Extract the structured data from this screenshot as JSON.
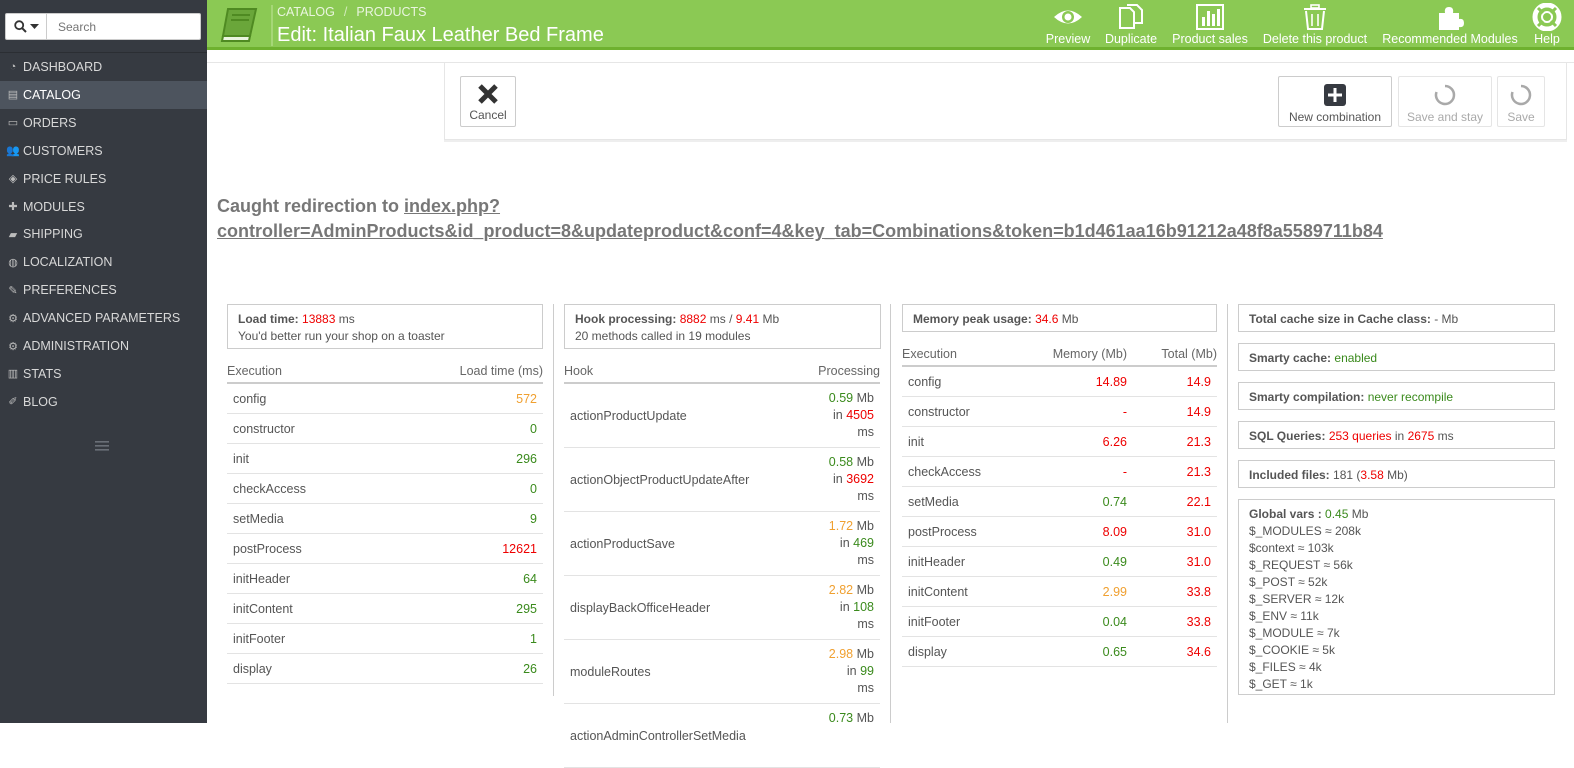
{
  "search": {
    "placeholder": "Search"
  },
  "sidebar": {
    "items": [
      {
        "label": "DASHBOARD",
        "icon": "dashboard-icon"
      },
      {
        "label": "CATALOG",
        "icon": "book-icon"
      },
      {
        "label": "ORDERS",
        "icon": "credit-card-icon"
      },
      {
        "label": "CUSTOMERS",
        "icon": "users-icon"
      },
      {
        "label": "PRICE RULES",
        "icon": "tags-icon"
      },
      {
        "label": "MODULES",
        "icon": "puzzle-icon"
      },
      {
        "label": "SHIPPING",
        "icon": "truck-icon"
      },
      {
        "label": "LOCALIZATION",
        "icon": "globe-icon"
      },
      {
        "label": "PREFERENCES",
        "icon": "wrench-icon"
      },
      {
        "label": "ADVANCED PARAMETERS",
        "icon": "cogs-icon"
      },
      {
        "label": "ADMINISTRATION",
        "icon": "cog-icon"
      },
      {
        "label": "STATS",
        "icon": "bar-chart-icon"
      },
      {
        "label": "BLOG",
        "icon": "edit-icon"
      }
    ],
    "active_index": 1
  },
  "header": {
    "breadcrumb": [
      "CATALOG",
      "PRODUCTS"
    ],
    "breadcrumb_sep": "/",
    "title": "Edit: Italian Faux Leather Bed Frame",
    "toolbar": {
      "preview": "Preview",
      "duplicate": "Duplicate",
      "product_sales": "Product sales",
      "delete": "Delete this product",
      "recommended": "Recommended Modules",
      "help": "Help"
    }
  },
  "actions": {
    "cancel": "Cancel",
    "new_combination": "New combination",
    "save_and_stay": "Save and stay",
    "save": "Save"
  },
  "redirect": {
    "prefix": "Caught redirection to ",
    "link_line1": "index.php?",
    "link_line2": "controller=AdminProducts&id_product=8&updateproduct&conf=4&key_tab=Combinations&token=b1d461aa16b91212a48f8a5589711b84"
  },
  "load_time": {
    "label": "Load time:",
    "value": "13883",
    "unit": "ms",
    "note": "You'd better run your shop on a toaster",
    "col1": "Execution",
    "col2": "Load time (ms)",
    "rows": [
      {
        "name": "config",
        "value": "572",
        "color": "orange"
      },
      {
        "name": "constructor",
        "value": "0",
        "color": "green"
      },
      {
        "name": "init",
        "value": "296",
        "color": "green"
      },
      {
        "name": "checkAccess",
        "value": "0",
        "color": "green"
      },
      {
        "name": "setMedia",
        "value": "9",
        "color": "green"
      },
      {
        "name": "postProcess",
        "value": "12621",
        "color": "red"
      },
      {
        "name": "initHeader",
        "value": "64",
        "color": "green"
      },
      {
        "name": "initContent",
        "value": "295",
        "color": "green"
      },
      {
        "name": "initFooter",
        "value": "1",
        "color": "green"
      },
      {
        "name": "display",
        "value": "26",
        "color": "green"
      }
    ]
  },
  "hooks": {
    "label": "Hook processing:",
    "time": "8882",
    "time_unit": "ms /",
    "mem": "9.41",
    "mem_unit": "Mb",
    "note": "20 methods called in 19 modules",
    "col1": "Hook",
    "col2": "Processing",
    "rows": [
      {
        "name": "actionProductUpdate",
        "mem": "0.59",
        "mem_color": "green",
        "time": "4505",
        "time_color": "red"
      },
      {
        "name": "actionObjectProductUpdateAfter",
        "mem": "0.58",
        "mem_color": "green",
        "time": "3692",
        "time_color": "red"
      },
      {
        "name": "actionProductSave",
        "mem": "1.72",
        "mem_color": "orange",
        "time": "469",
        "time_color": "green"
      },
      {
        "name": "displayBackOfficeHeader",
        "mem": "2.82",
        "mem_color": "orange",
        "time": "108",
        "time_color": "green"
      },
      {
        "name": "moduleRoutes",
        "mem": "2.98",
        "mem_color": "orange",
        "time": "99",
        "time_color": "green"
      },
      {
        "name": "actionAdminControllerSetMedia",
        "mem": "0.73",
        "mem_color": "green",
        "time": "",
        "time_color": "green"
      }
    ],
    "mb": "Mb",
    "in": "in",
    "ms": "ms"
  },
  "memory": {
    "label": "Memory peak usage:",
    "value": "34.6",
    "unit": "Mb",
    "col1": "Execution",
    "col2": "Memory (Mb)",
    "col3": "Total (Mb)",
    "rows": [
      {
        "name": "config",
        "mem": "14.89",
        "mem_color": "red",
        "total": "14.9"
      },
      {
        "name": "constructor",
        "mem": "-",
        "mem_color": "red",
        "total": "14.9"
      },
      {
        "name": "init",
        "mem": "6.26",
        "mem_color": "red",
        "total": "21.3"
      },
      {
        "name": "checkAccess",
        "mem": "-",
        "mem_color": "red",
        "total": "21.3"
      },
      {
        "name": "setMedia",
        "mem": "0.74",
        "mem_color": "green",
        "total": "22.1"
      },
      {
        "name": "postProcess",
        "mem": "8.09",
        "mem_color": "red",
        "total": "31.0"
      },
      {
        "name": "initHeader",
        "mem": "0.49",
        "mem_color": "green",
        "total": "31.0"
      },
      {
        "name": "initContent",
        "mem": "2.99",
        "mem_color": "orange",
        "total": "33.8"
      },
      {
        "name": "initFooter",
        "mem": "0.04",
        "mem_color": "green",
        "total": "33.8"
      },
      {
        "name": "display",
        "mem": "0.65",
        "mem_color": "green",
        "total": "34.6"
      }
    ]
  },
  "cache": {
    "total_label": "Total cache size in Cache class:",
    "total_value": "- Mb",
    "smarty_cache_label": "Smarty cache:",
    "smarty_cache_value": "enabled",
    "smarty_comp_label": "Smarty compilation:",
    "smarty_comp_value": "never recompile",
    "sql_label": "SQL Queries:",
    "sql_value": "253 queries",
    "sql_in": "in",
    "sql_time": "2675",
    "sql_unit": "ms",
    "files_label": "Included files:",
    "files_count": "181 (",
    "files_size": "3.58",
    "files_unit": "Mb)",
    "globals_label": "Global vars :",
    "globals_value": "0.45",
    "globals_unit": "Mb",
    "globals": [
      "$_MODULES ≈ 208k",
      "$context ≈ 103k",
      "$_REQUEST ≈ 56k",
      "$_POST ≈ 52k",
      "$_SERVER ≈ 12k",
      "$_ENV ≈ 11k",
      "$_MODULE ≈ 7k",
      "$_COOKIE ≈ 5k",
      "$_FILES ≈ 4k",
      "$_GET ≈ 1k"
    ]
  },
  "colors": {
    "header_green": "#8bc954",
    "sidebar_bg": "#363a41",
    "red": "#ee0000",
    "green": "#3a8a1c",
    "orange": "#f0a030"
  }
}
